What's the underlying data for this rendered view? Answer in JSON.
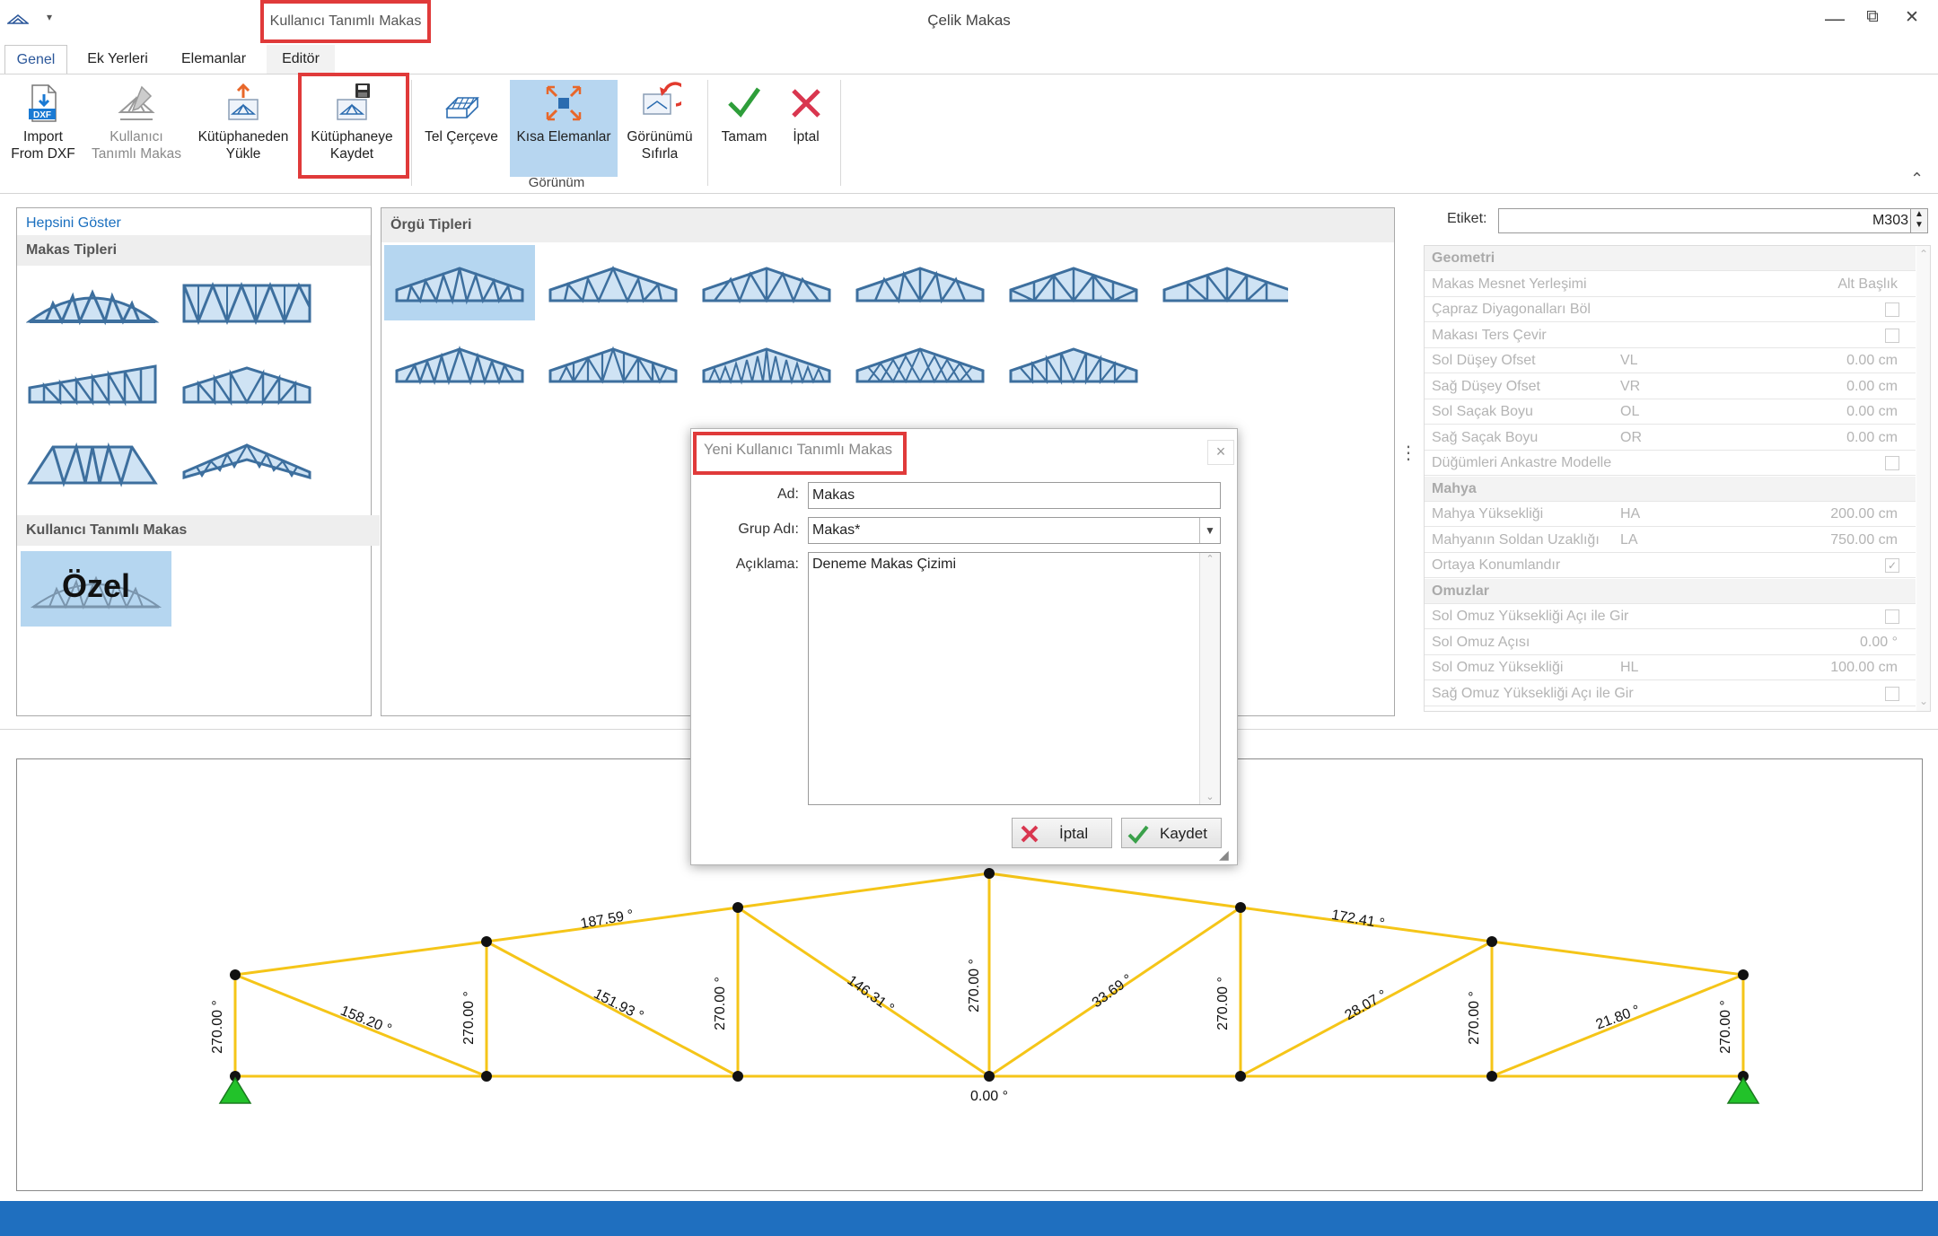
{
  "window": {
    "title": "Çelik Makas",
    "contextual_title": "Kullanıcı Tanımlı Makas",
    "minimize": "—",
    "restore": "⧉",
    "close": "✕"
  },
  "tabs": [
    {
      "label": "Genel",
      "active": true
    },
    {
      "label": "Ek Yerleri",
      "active": false
    },
    {
      "label": "Elemanlar",
      "active": false
    },
    {
      "label": "Editör",
      "active": false
    }
  ],
  "ribbon": {
    "import_dxf": "Import\nFrom DXF",
    "kullanici_tanimli": "Kullanıcı\nTanımlı Makas",
    "kutuphaneden_yukle": "Kütüphaneden\nYükle",
    "kutuphaneye_kaydet": "Kütüphaneye\nKaydet",
    "tel_cerceve": "Tel Çerçeve",
    "kisa_elemanlar": "Kısa Elemanlar",
    "gorunumu_sifirla": "Görünümü\nSıfırla",
    "tamam": "Tamam",
    "iptal": "İptal",
    "group_gorunum": "Görünüm",
    "collapse": "⌃"
  },
  "left_panel": {
    "show_all_link": "Hepsini Göster",
    "makas_tipleri_header": "Makas Tipleri",
    "kullanici_header": "Kullanıcı Tanımlı Makas",
    "custom_tile_label": "Özel"
  },
  "orgu_panel": {
    "header": "Örgü Tipleri"
  },
  "properties": {
    "etiket_label": "Etiket:",
    "etiket_value": "M303",
    "rows": [
      {
        "type": "cat",
        "name": "Geometri"
      },
      {
        "name": "Makas Mesnet Yerleşimi",
        "code": "",
        "value": "Alt Başlık"
      },
      {
        "name": "Çapraz Diyagonalları Böl",
        "code": "",
        "check": true,
        "checked": false
      },
      {
        "name": "Makası Ters Çevir",
        "code": "",
        "check": true,
        "checked": false
      },
      {
        "name": "Sol Düşey Ofset",
        "code": "VL",
        "value": "0.00 cm"
      },
      {
        "name": "Sağ Düşey Ofset",
        "code": "VR",
        "value": "0.00 cm"
      },
      {
        "name": "Sol Saçak Boyu",
        "code": "OL",
        "value": "0.00 cm"
      },
      {
        "name": "Sağ Saçak Boyu",
        "code": "OR",
        "value": "0.00 cm"
      },
      {
        "name": "Düğümleri Ankastre Modelle",
        "code": "",
        "check": true,
        "checked": false
      },
      {
        "type": "cat",
        "name": "Mahya"
      },
      {
        "name": "Mahya Yüksekliği",
        "code": "HA",
        "value": "200.00 cm"
      },
      {
        "name": "Mahyanın Soldan Uzaklığı",
        "code": "LA",
        "value": "750.00 cm"
      },
      {
        "name": "Ortaya Konumlandır",
        "code": "",
        "check": true,
        "checked": true
      },
      {
        "type": "cat",
        "name": "Omuzlar"
      },
      {
        "name": "Sol Omuz Yüksekliği Açı ile Gir",
        "code": "",
        "check": true,
        "checked": false
      },
      {
        "name": "Sol Omuz Açısı",
        "code": "",
        "value": "0.00 °"
      },
      {
        "name": "Sol Omuz Yüksekliği",
        "code": "HL",
        "value": "100.00 cm"
      },
      {
        "name": "Sağ Omuz Yüksekliği Açı ile Gir",
        "code": "",
        "check": true,
        "checked": false
      }
    ]
  },
  "dialog": {
    "title": "Yeni Kullanıcı Tanımlı Makas",
    "close": "×",
    "ad_label": "Ad:",
    "ad_value": "Makas",
    "grup_label": "Grup Adı:",
    "grup_value": "Makas*",
    "aciklama_label": "Açıklama:",
    "aciklama_value": "Deneme Makas Çizimi",
    "iptal_button": "İptal",
    "kaydet_button": "Kaydet"
  },
  "truss": {
    "color": "#f5c518",
    "angles": [
      {
        "text": "270.00 °"
      },
      {
        "text": "270.00 °"
      },
      {
        "text": "270.00 °"
      },
      {
        "text": "270.00 °"
      },
      {
        "text": "270.00 °"
      },
      {
        "text": "270.00 °"
      },
      {
        "text": "270.00 °"
      },
      {
        "text": "187.59 °"
      },
      {
        "text": "172.41 °"
      },
      {
        "text": "158.20 °"
      },
      {
        "text": "151.93 °"
      },
      {
        "text": "146.31 °"
      },
      {
        "text": "33.69 °"
      },
      {
        "text": "28.07 °"
      },
      {
        "text": "21.80 °"
      },
      {
        "text": "0.00 °"
      }
    ]
  },
  "colors": {
    "accent": "#2b579a",
    "selection": "#b5d6f0",
    "highlight_box": "#e03a3a",
    "support": "#22c22a",
    "statusbar": "#1f6fbf"
  }
}
